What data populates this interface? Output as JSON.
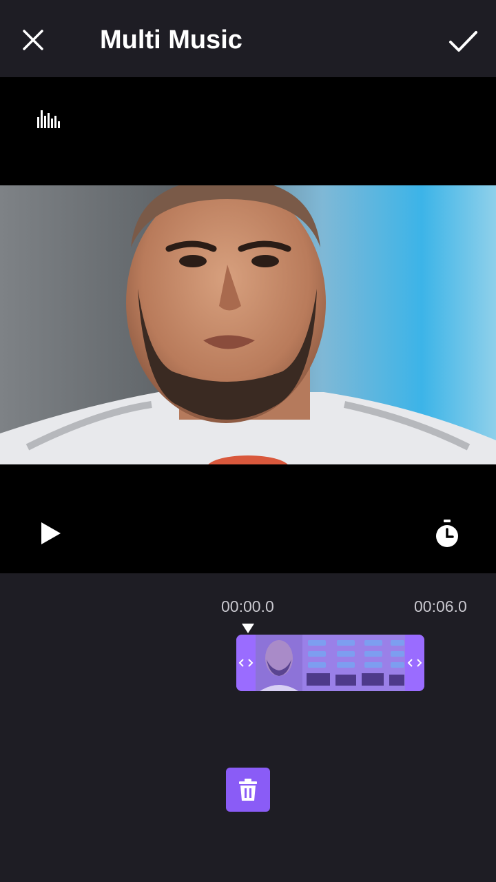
{
  "header": {
    "title": "Multi Music",
    "close_icon": "close-icon",
    "confirm_icon": "checkmark-icon"
  },
  "preview": {
    "visualizer_icon": "audio-visualizer-icon",
    "play_icon": "play-icon",
    "timer_icon": "stopwatch-icon"
  },
  "timeline": {
    "start_time": "00:00.0",
    "end_time": "00:06.0",
    "playhead_icon": "playhead-marker-icon"
  },
  "actions": {
    "delete_icon": "trash-icon"
  },
  "colors": {
    "background": "#1e1d24",
    "accent": "#8a5cf6",
    "preview_bg": "#000000",
    "text": "#ffffff",
    "muted_text": "#c9c8cf"
  }
}
